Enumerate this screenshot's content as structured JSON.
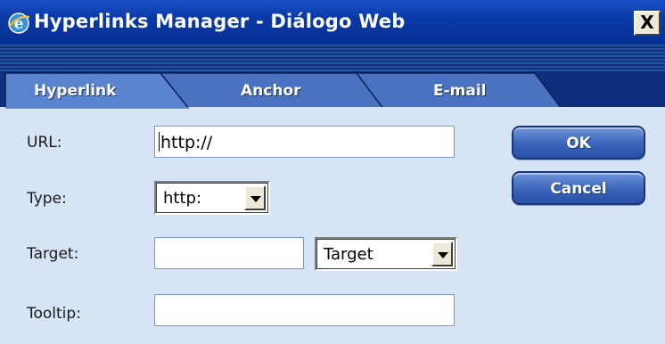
{
  "window": {
    "title": "Hyperlinks Manager - Diálogo Web",
    "close_label": "X"
  },
  "tabs": [
    {
      "label": "Hyperlink",
      "active": true
    },
    {
      "label": "Anchor",
      "active": false
    },
    {
      "label": "E-mail",
      "active": false
    }
  ],
  "form": {
    "url": {
      "label": "URL:",
      "value": "http://"
    },
    "type": {
      "label": "Type:",
      "selected": "http:"
    },
    "target": {
      "label": "Target:",
      "value": "",
      "dropdown_selected": "Target"
    },
    "tooltip": {
      "label": "Tooltip:",
      "value": ""
    }
  },
  "buttons": {
    "ok_label": "OK",
    "cancel_label": "Cancel"
  },
  "colors": {
    "titlebar": "#0a3aa8",
    "panel_bg": "#d6e4f6",
    "tab_fill": "#4a72c0",
    "button_fill": "#3a64bb"
  }
}
